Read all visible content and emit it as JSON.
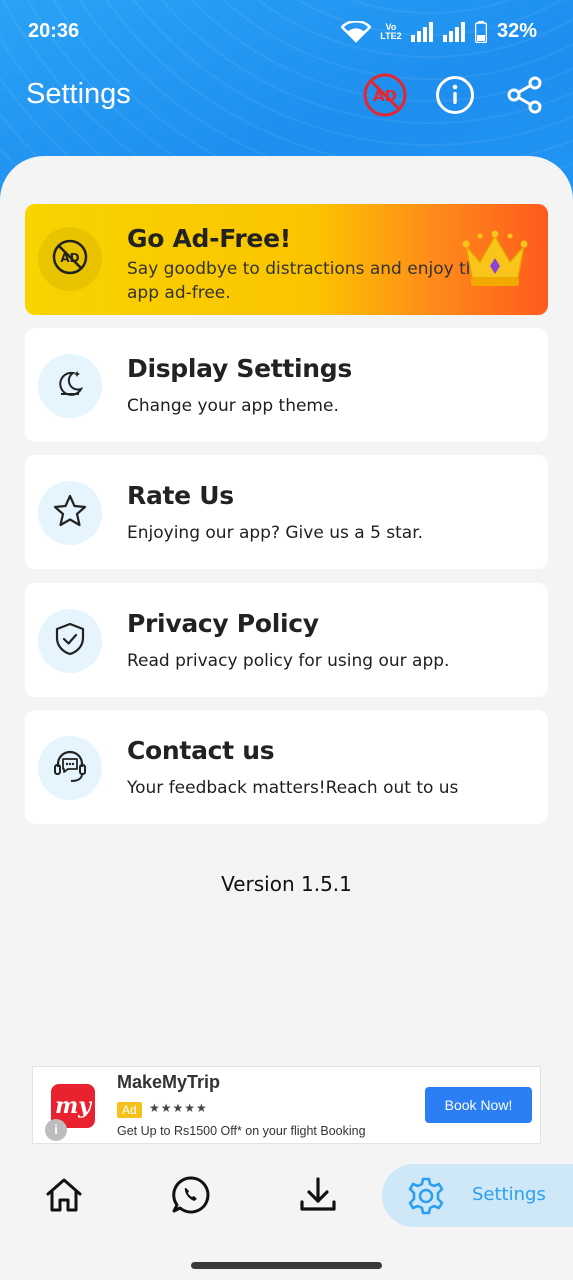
{
  "status_bar": {
    "time": "20:36",
    "network_label": "Vo LTE2",
    "battery": "32%"
  },
  "header": {
    "title": "Settings",
    "icons": [
      "no-ads-icon",
      "info-icon",
      "share-icon"
    ]
  },
  "cards": [
    {
      "id": "go-ad-free",
      "title": "Go Ad-Free!",
      "subtitle": "Say goodbye to distractions and enjoy the app ad-free.",
      "icon": "no-ads-icon"
    },
    {
      "id": "display-settings",
      "title": "Display Settings",
      "subtitle": "Change your app theme.",
      "icon": "moon-icon"
    },
    {
      "id": "rate-us",
      "title": "Rate Us",
      "subtitle": "Enjoying our app? Give us a 5 star.",
      "icon": "star-icon"
    },
    {
      "id": "privacy-policy",
      "title": "Privacy Policy",
      "subtitle": "Read privacy policy for using our app.",
      "icon": "shield-icon"
    },
    {
      "id": "contact-us",
      "title": "Contact us",
      "subtitle": "Your feedback matters!Reach out to us",
      "icon": "headset-icon"
    }
  ],
  "version": "Version 1.5.1",
  "ad": {
    "logo_text": "my",
    "title": "MakeMyTrip",
    "badge": "Ad",
    "stars": "★★★★★",
    "description": "Get Up to Rs1500 Off* on your flight Booking",
    "cta": "Book Now!",
    "info": "i"
  },
  "bottom_nav": {
    "items": [
      "home-icon",
      "whatsapp-icon",
      "download-icon",
      "settings-icon"
    ],
    "active_label": "Settings"
  },
  "colors": {
    "header_blue": "#1e8eef",
    "accent_blue": "#2d9ff0",
    "ad_free_gradient_start": "#f8d400",
    "ad_free_gradient_end": "#ff5a1e",
    "nav_active_bg": "#cfe8f7"
  }
}
